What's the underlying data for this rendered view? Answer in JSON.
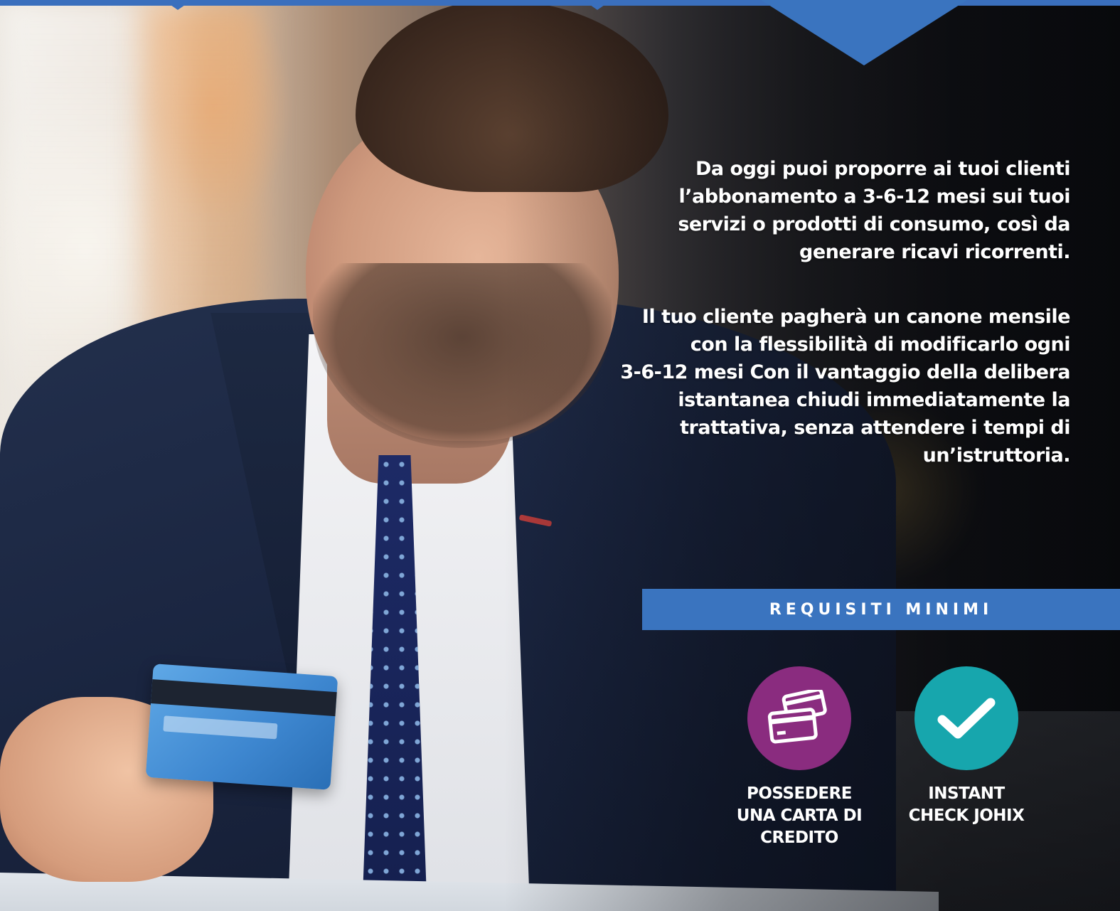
{
  "paragraphs": [
    "Da oggi puoi proporre ai tuoi clienti\nl’abbonamento a 3-6-12 mesi sui tuoi\nservizi o prodotti di consumo, così da\ngenerare ricavi ricorrenti.",
    "Il tuo cliente pagherà un canone mensile\ncon la flessibilità di modificarlo ogni\n3-6-12 mesi Con il vantaggio della delibera\nistantanea chiudi immediatamente la\ntrattativa, senza attendere i tempi di\nun’istruttoria."
  ],
  "requirements": {
    "title": "REQUISITI MINIMI",
    "items": [
      {
        "label": "POSSEDERE\nUNA CARTA DI\nCREDITO",
        "icon": "credit-cards-icon",
        "color": "#8a2c7f"
      },
      {
        "label": "INSTANT\nCHECK JOHIX",
        "icon": "checkmark-icon",
        "color": "#17a6ad"
      }
    ]
  },
  "colors": {
    "accent_blue": "#3a74bf",
    "text": "#ffffff"
  }
}
